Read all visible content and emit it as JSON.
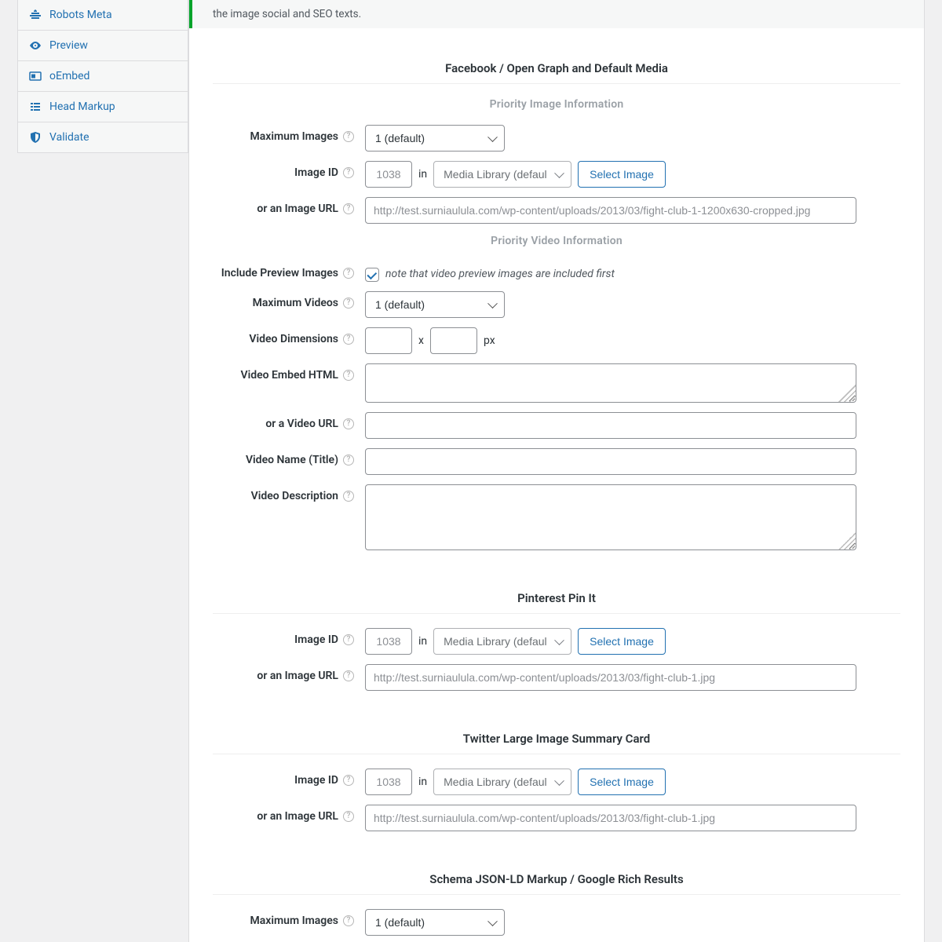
{
  "sidebar": {
    "items": [
      {
        "label": "Robots Meta"
      },
      {
        "label": "Preview"
      },
      {
        "label": "oEmbed"
      },
      {
        "label": "Head Markup"
      },
      {
        "label": "Validate"
      }
    ]
  },
  "notice": "the image social and SEO texts.",
  "sections": {
    "og": {
      "title": "Facebook / Open Graph and Default Media",
      "sub_image": "Priority Image Information",
      "sub_video": "Priority Video Information",
      "max_images_label": "Maximum Images",
      "max_images_value": "1 (default)",
      "image_id_label": "Image ID",
      "image_id_placeholder": "1038",
      "in_text": "in",
      "media_library": "Media Library (defaul",
      "select_image": "Select Image",
      "image_url_label": "or an Image URL",
      "image_url_placeholder": "http://test.surniaulula.com/wp-content/uploads/2013/03/fight-club-1-1200x630-cropped.jpg",
      "include_preview_label": "Include Preview Images",
      "include_preview_note": "note that video preview images are included first",
      "max_videos_label": "Maximum Videos",
      "max_videos_value": "1 (default)",
      "video_dim_label": "Video Dimensions",
      "x_text": "x",
      "px_text": "px",
      "video_embed_label": "Video Embed HTML",
      "video_url_label": "or a Video URL",
      "video_name_label": "Video Name (Title)",
      "video_desc_label": "Video Description"
    },
    "pin": {
      "title": "Pinterest Pin It",
      "image_id_label": "Image ID",
      "image_id_placeholder": "1038",
      "in_text": "in",
      "media_library": "Media Library (defaul",
      "select_image": "Select Image",
      "image_url_label": "or an Image URL",
      "image_url_placeholder": "http://test.surniaulula.com/wp-content/uploads/2013/03/fight-club-1.jpg"
    },
    "tw": {
      "title": "Twitter Large Image Summary Card",
      "image_id_label": "Image ID",
      "image_id_placeholder": "1038",
      "in_text": "in",
      "media_library": "Media Library (defaul",
      "select_image": "Select Image",
      "image_url_label": "or an Image URL",
      "image_url_placeholder": "http://test.surniaulula.com/wp-content/uploads/2013/03/fight-club-1.jpg"
    },
    "schema": {
      "title": "Schema JSON-LD Markup / Google Rich Results",
      "max_images_label": "Maximum Images",
      "max_images_value": "1 (default)"
    }
  }
}
